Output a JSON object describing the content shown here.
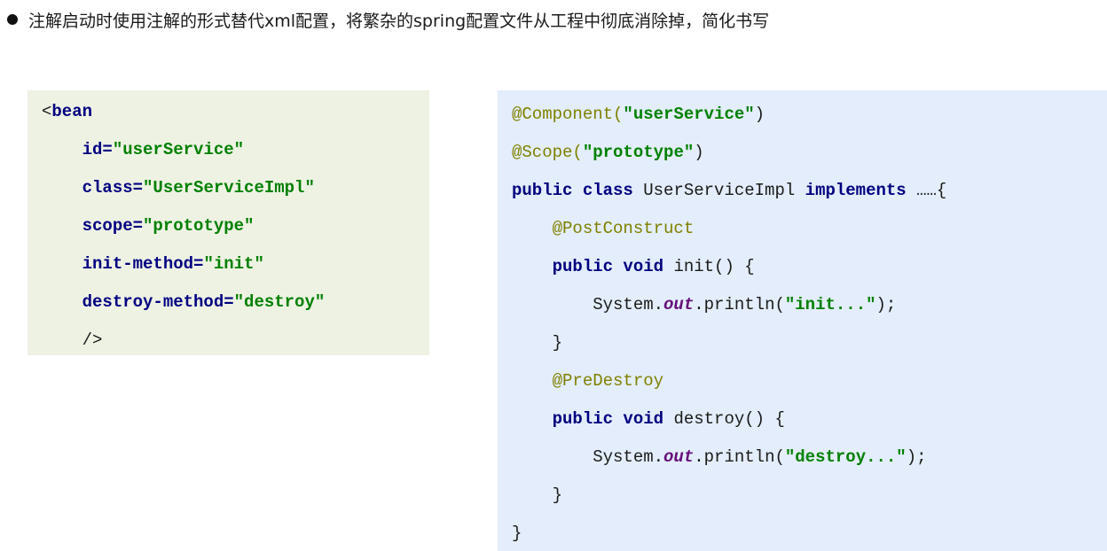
{
  "header": {
    "text": "注解启动时使用注解的形式替代xml配置，将繁杂的spring配置文件从工程中彻底消除掉，简化书写"
  },
  "xml_panel": {
    "lines": [
      [
        {
          "t": "<",
          "c": "plain"
        },
        {
          "t": "bean",
          "c": "kw"
        }
      ],
      [
        {
          "t": "    ",
          "c": "plain"
        },
        {
          "t": "id=",
          "c": "kw"
        },
        {
          "t": "\"userService\"",
          "c": "str"
        }
      ],
      [
        {
          "t": "    ",
          "c": "plain"
        },
        {
          "t": "class=",
          "c": "kw"
        },
        {
          "t": "\"UserServiceImpl\"",
          "c": "str"
        }
      ],
      [
        {
          "t": "    ",
          "c": "plain"
        },
        {
          "t": "scope=",
          "c": "kw"
        },
        {
          "t": "\"prototype\"",
          "c": "str"
        }
      ],
      [
        {
          "t": "    ",
          "c": "plain"
        },
        {
          "t": "init-method=",
          "c": "kw"
        },
        {
          "t": "\"init\"",
          "c": "str"
        }
      ],
      [
        {
          "t": "    ",
          "c": "plain"
        },
        {
          "t": "destroy-method=",
          "c": "kw"
        },
        {
          "t": "\"destroy\"",
          "c": "str"
        }
      ],
      [
        {
          "t": "    />",
          "c": "plain"
        }
      ]
    ]
  },
  "java_panel": {
    "lines": [
      [
        {
          "t": "@Component(",
          "c": "ann"
        },
        {
          "t": "\"userService\"",
          "c": "str"
        },
        {
          "t": ")",
          "c": "plain"
        }
      ],
      [
        {
          "t": "@Scope(",
          "c": "ann"
        },
        {
          "t": "\"prototype\"",
          "c": "str"
        },
        {
          "t": ")",
          "c": "plain"
        }
      ],
      [
        {
          "t": "public class ",
          "c": "kw"
        },
        {
          "t": "UserServiceImpl ",
          "c": "plain"
        },
        {
          "t": "implements",
          "c": "kw"
        },
        {
          "t": " ……{",
          "c": "plain"
        }
      ],
      [
        {
          "t": "    ",
          "c": "plain"
        },
        {
          "t": "@PostConstruct",
          "c": "ann"
        }
      ],
      [
        {
          "t": "    ",
          "c": "plain"
        },
        {
          "t": "public void ",
          "c": "kw"
        },
        {
          "t": "init() {",
          "c": "plain"
        }
      ],
      [
        {
          "t": "        System.",
          "c": "plain"
        },
        {
          "t": "out",
          "c": "field"
        },
        {
          "t": ".println(",
          "c": "plain"
        },
        {
          "t": "\"init...\"",
          "c": "str"
        },
        {
          "t": ");",
          "c": "plain"
        }
      ],
      [
        {
          "t": "    }",
          "c": "plain"
        }
      ],
      [
        {
          "t": "    ",
          "c": "plain"
        },
        {
          "t": "@PreDestroy",
          "c": "ann"
        }
      ],
      [
        {
          "t": "    ",
          "c": "plain"
        },
        {
          "t": "public void ",
          "c": "kw"
        },
        {
          "t": "destroy() {",
          "c": "plain"
        }
      ],
      [
        {
          "t": "        System.",
          "c": "plain"
        },
        {
          "t": "out",
          "c": "field"
        },
        {
          "t": ".println(",
          "c": "plain"
        },
        {
          "t": "\"destroy...\"",
          "c": "str"
        },
        {
          "t": ");",
          "c": "plain"
        }
      ],
      [
        {
          "t": "    }",
          "c": "plain"
        }
      ],
      [
        {
          "t": "}",
          "c": "plain"
        }
      ]
    ]
  }
}
